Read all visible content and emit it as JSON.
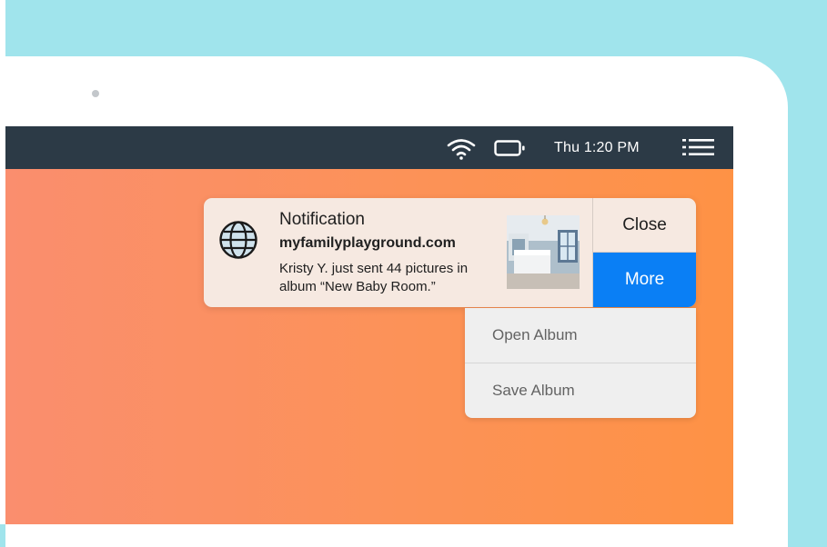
{
  "menubar": {
    "clock": "Thu 1:20 PM",
    "icons": [
      "wifi-icon",
      "battery-icon",
      "menu-list-icon"
    ]
  },
  "notification": {
    "icon": "globe-icon",
    "title": "Notification",
    "source": "myfamilyplayground.com",
    "body": "Kristy Y. just sent 44 pictures in album “New Baby Room.”",
    "close_label": "Close",
    "more_label": "More"
  },
  "dropdown": {
    "items": [
      {
        "label": "Open Album"
      },
      {
        "label": "Save Album"
      }
    ]
  },
  "colors": {
    "background": "#a0e4ec",
    "menubar": "#2c3a46",
    "accent": "#0a7ff5",
    "notification_bg": "#f6e9e1",
    "dropdown_bg": "#efefef"
  }
}
